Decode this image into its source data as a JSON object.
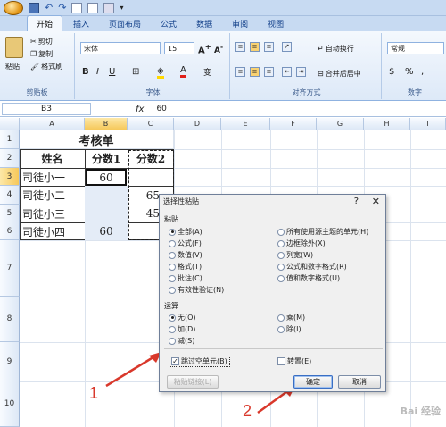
{
  "tabs": [
    "开始",
    "插入",
    "页面布局",
    "公式",
    "数据",
    "审阅",
    "视图"
  ],
  "ribbon": {
    "clipboard": {
      "paste": "粘贴",
      "cut": "剪切",
      "copy": "复制",
      "format_painter": "格式刷",
      "label": "剪贴板"
    },
    "font": {
      "name": "宋体",
      "size": "15",
      "label": "字体"
    },
    "alignment": {
      "wrap": "自动换行",
      "merge": "合并后居中",
      "label": "对齐方式"
    },
    "number": {
      "format": "常规",
      "label": "数字"
    }
  },
  "formula_bar": {
    "name_box": "B3",
    "fx": "fx",
    "value": "60"
  },
  "columns": [
    "A",
    "B",
    "C",
    "D",
    "E",
    "F",
    "G",
    "H",
    "I"
  ],
  "rows": [
    "1",
    "2",
    "3",
    "4",
    "5",
    "6",
    "7",
    "8",
    "9",
    "10"
  ],
  "sheet": {
    "title": "考核单",
    "headers": [
      "姓名",
      "分数1",
      "分数2"
    ],
    "data": [
      [
        "司徒小一",
        "60",
        ""
      ],
      [
        "司徒小二",
        "",
        "65"
      ],
      [
        "司徒小三",
        "",
        "45"
      ],
      [
        "司徒小四",
        "60",
        ""
      ]
    ]
  },
  "dialog": {
    "title": "选择性粘贴",
    "help": "?",
    "close": "✕",
    "paste_label": "粘贴",
    "paste_options_left": [
      "全部(A)",
      "公式(F)",
      "数值(V)",
      "格式(T)",
      "批注(C)",
      "有效性验证(N)"
    ],
    "paste_options_right": [
      "所有使用源主题的单元(H)",
      "边框除外(X)",
      "列宽(W)",
      "公式和数字格式(R)",
      "值和数字格式(U)"
    ],
    "operation_label": "运算",
    "operation_left": [
      "无(O)",
      "加(D)",
      "减(S)"
    ],
    "operation_right": [
      "乘(M)",
      "除(I)"
    ],
    "skip_blanks": "跳过空单元(B)",
    "transpose": "转置(E)",
    "paste_link": "粘贴链接(L)",
    "ok": "确定",
    "cancel": "取消"
  },
  "annotations": {
    "step1": "1",
    "step2": "2"
  },
  "watermark": "Bai 经验"
}
